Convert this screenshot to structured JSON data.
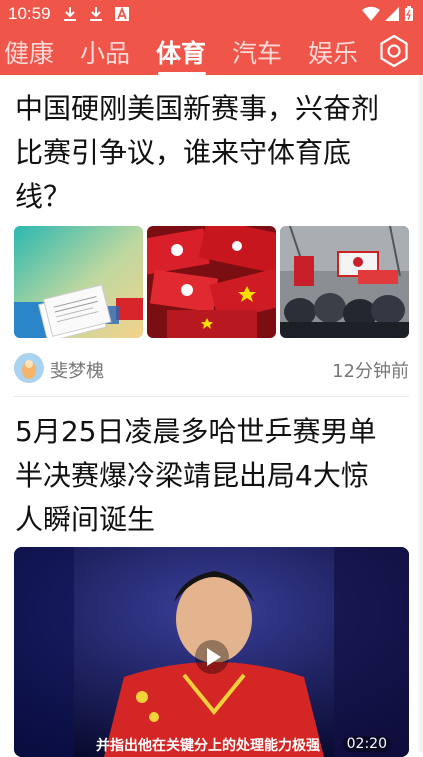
{
  "status_bar": {
    "time": "10:59",
    "icons": [
      "download-icon",
      "download-icon",
      "a-icon",
      "wifi-icon",
      "signal-icon",
      "battery-icon"
    ],
    "background": "#f0554a"
  },
  "tabs": [
    {
      "label": "健康"
    },
    {
      "label": "小品"
    },
    {
      "label": "体育",
      "active": true
    },
    {
      "label": "汽车"
    },
    {
      "label": "娱乐"
    }
  ],
  "settings_icon": "settings-icon",
  "articles": [
    {
      "title_lines": [
        "中国硬刚美国新赛事，兴奋剂",
        "比赛引争议，谁来守体育底",
        "线？"
      ],
      "thumbnails": [
        "document-photo",
        "flags-photo",
        "protest-photo"
      ],
      "author": "斐梦槐",
      "time_ago": "12分钟前"
    },
    {
      "title_lines": [
        "5月25日凌晨多哈世乒赛男单",
        "半决赛爆冷梁靖昆出局4大惊",
        "人瞬间诞生"
      ],
      "video": {
        "caption": "并指出他在关键分上的处理能力极强",
        "duration": "02:20"
      }
    }
  ],
  "colors": {
    "accent": "#f0554a",
    "text": "#111111",
    "muted": "#777777"
  }
}
